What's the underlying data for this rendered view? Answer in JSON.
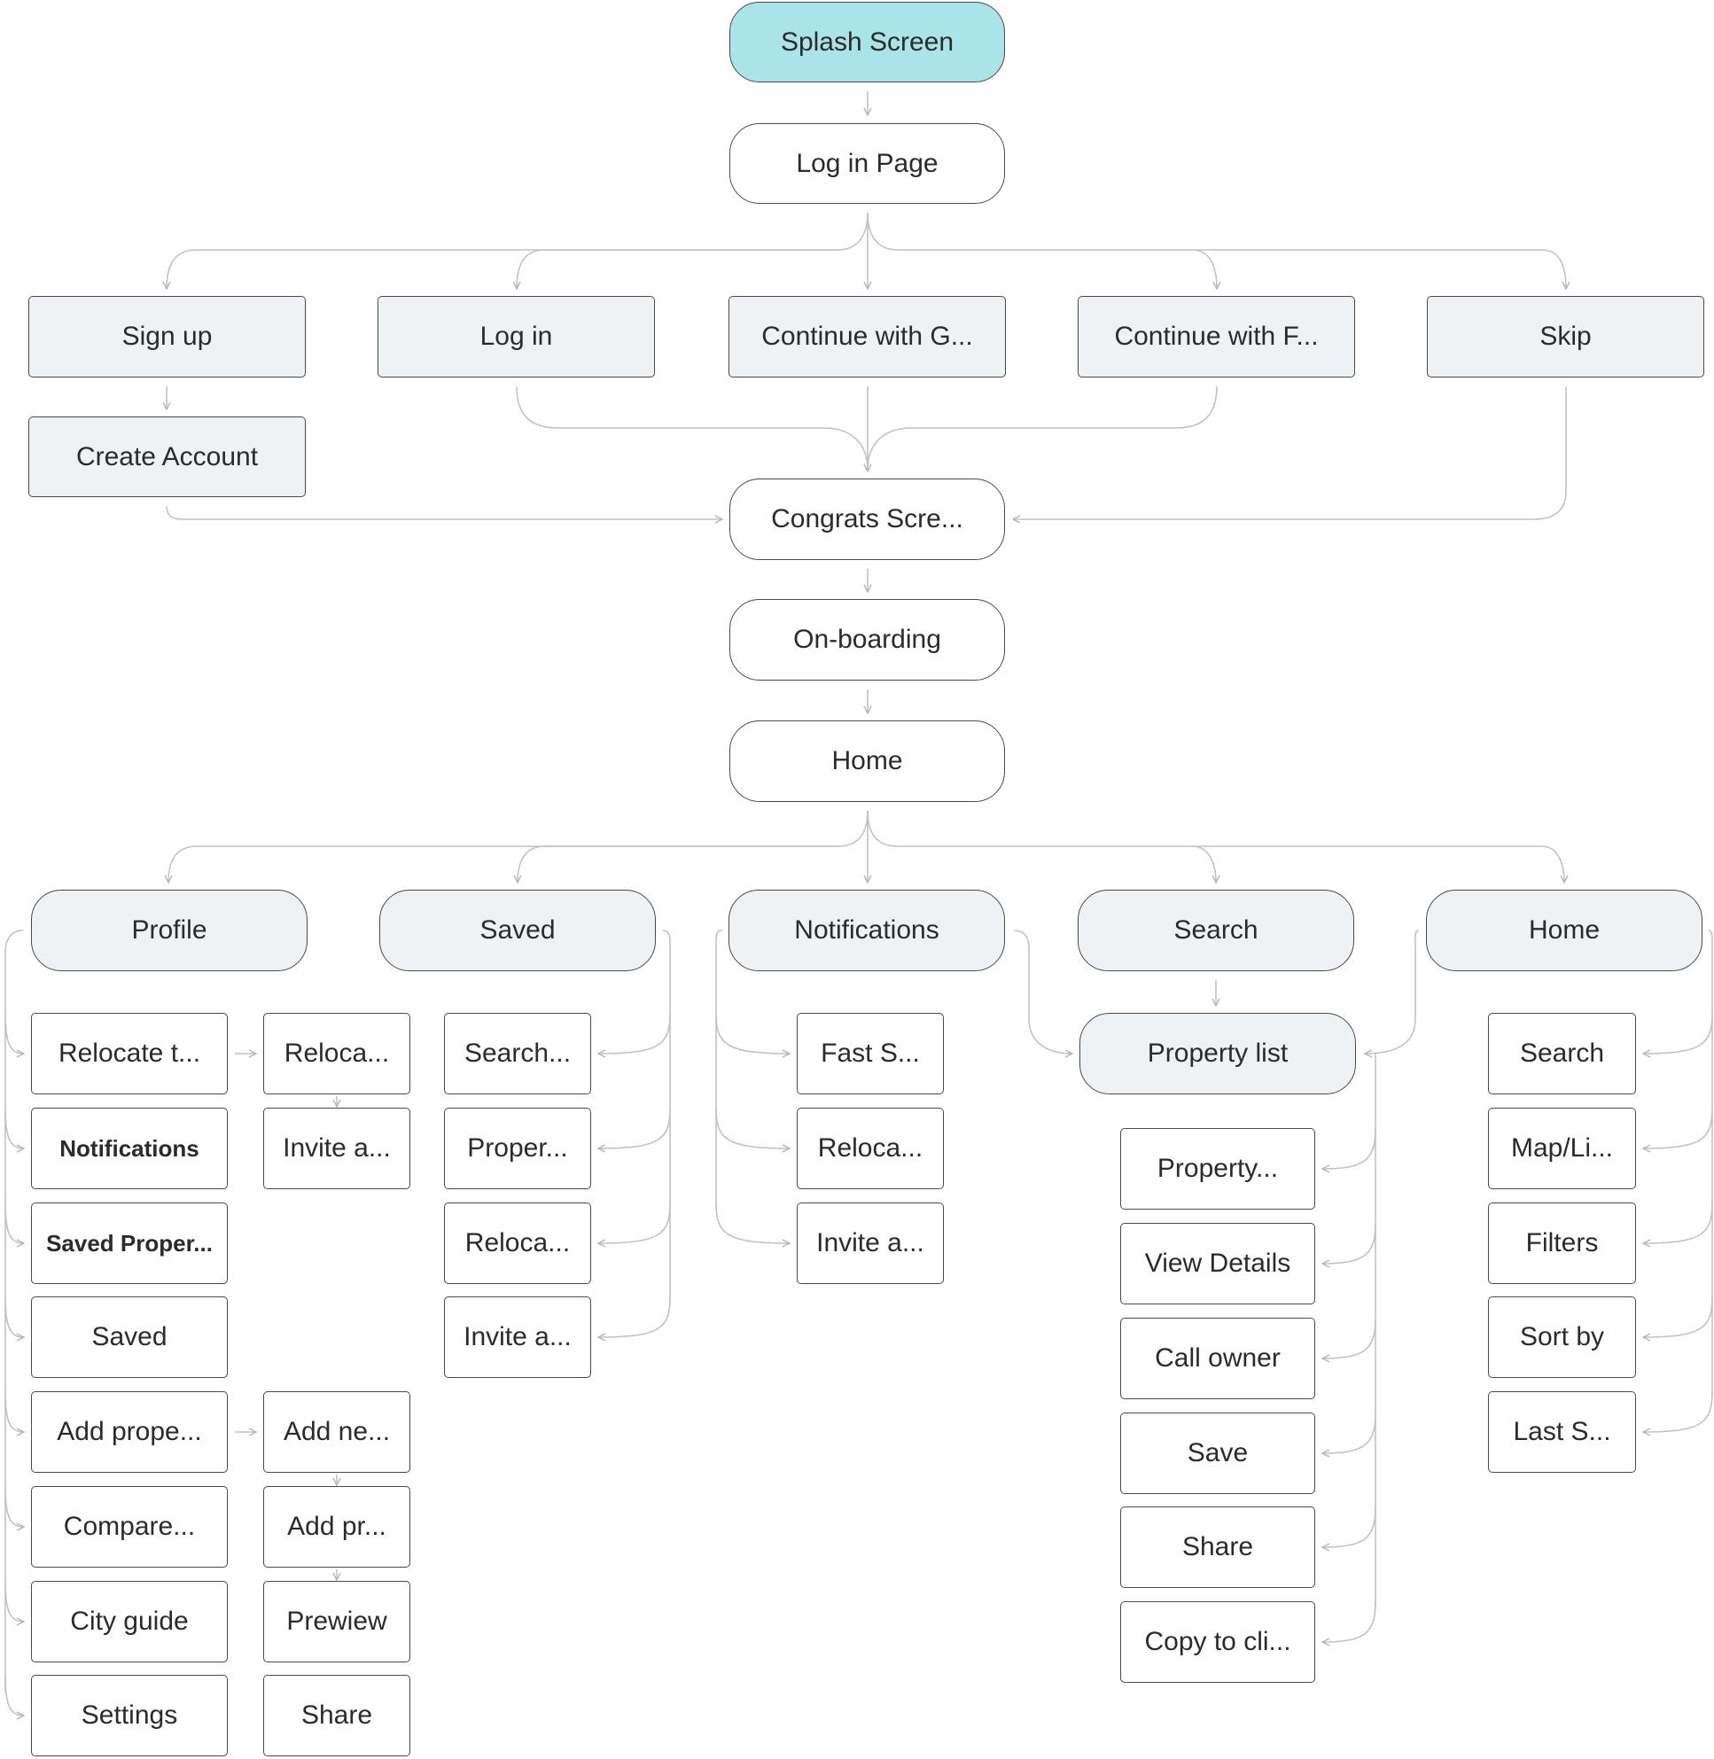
{
  "diagram": {
    "type": "sitemap-flowchart",
    "colors": {
      "splash_fill": "#abe4e8",
      "section_fill": "#eef2f5",
      "screen_fill": "#ffffff",
      "border": "#4a4a4a",
      "connector": "#c2c2c2",
      "text": "#2b2b2b"
    },
    "nodes": {
      "splash": "Splash Screen",
      "login_page": "Log in Page",
      "signup": "Sign up",
      "login": "Log in",
      "continue_google": "Continue with G...",
      "continue_facebook": "Continue with F...",
      "skip": "Skip",
      "create_account": "Create Account",
      "congrats": "Congrats Scre...",
      "onboarding": "On-boarding",
      "home": "Home",
      "tab_profile": "Profile",
      "tab_saved": "Saved",
      "tab_notifications": "Notifications",
      "tab_search": "Search",
      "tab_home": "Home",
      "property_list": "Property list"
    },
    "profile": {
      "items": [
        "Relocate t...",
        "Notifications",
        "Saved Proper...",
        "Saved",
        "Add prope...",
        "Compare...",
        "City guide",
        "Settings"
      ],
      "sub_relocate": [
        "Reloca...",
        "Invite a..."
      ],
      "sub_add_property": [
        "Add ne...",
        "Add pr...",
        "Prewiew",
        "Share"
      ]
    },
    "saved": {
      "items": [
        "Search...",
        "Proper...",
        "Reloca...",
        "Invite a..."
      ]
    },
    "notifications": {
      "items": [
        "Fast S...",
        "Reloca...",
        "Invite a..."
      ]
    },
    "property_list": {
      "items": [
        "Property...",
        "View Details",
        "Call owner",
        "Save",
        "Share",
        "Copy to cli..."
      ]
    },
    "home_tab": {
      "items": [
        "Search",
        "Map/Li...",
        "Filters",
        "Sort by",
        "Last S..."
      ]
    }
  }
}
